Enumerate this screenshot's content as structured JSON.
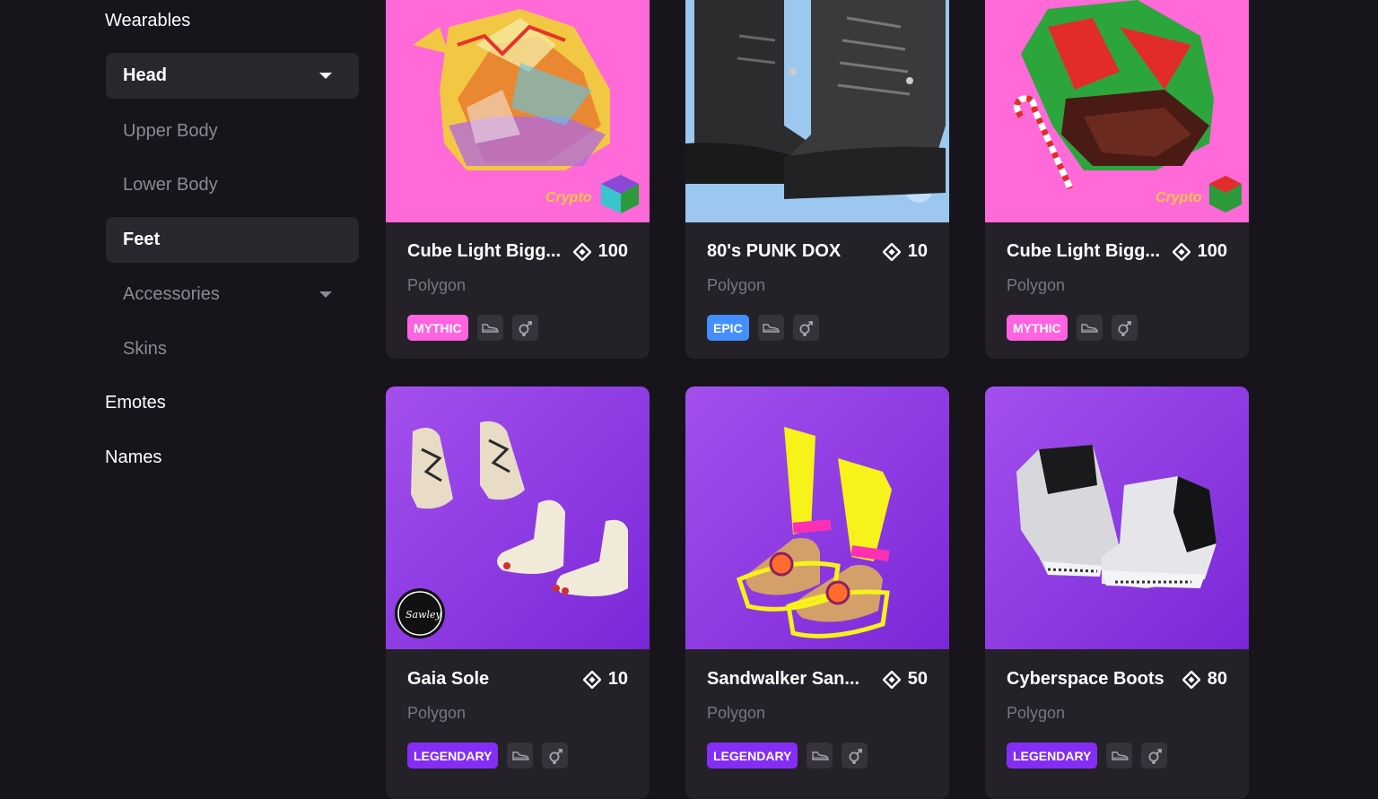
{
  "sidebar": {
    "wearables_title": "Wearables",
    "items": [
      {
        "label": "Head"
      },
      {
        "label": "Upper Body"
      },
      {
        "label": "Lower Body"
      },
      {
        "label": "Feet"
      },
      {
        "label": "Accessories"
      },
      {
        "label": "Skins"
      }
    ],
    "emotes_title": "Emotes",
    "names_title": "Names"
  },
  "cards": [
    {
      "name": "Cube Light Bigg...",
      "price": "100",
      "network": "Polygon",
      "rarity": "MYTHIC",
      "rarity_color": "#ff63e1"
    },
    {
      "name": "80's PUNK DOX",
      "price": "10",
      "network": "Polygon",
      "rarity": "EPIC",
      "rarity_color": "#438fff"
    },
    {
      "name": "Cube Light Bigg...",
      "price": "100",
      "network": "Polygon",
      "rarity": "MYTHIC",
      "rarity_color": "#ff63e1"
    },
    {
      "name": "Gaia Sole",
      "price": "10",
      "network": "Polygon",
      "rarity": "LEGENDARY",
      "rarity_color": "#842df4"
    },
    {
      "name": "Sandwalker San...",
      "price": "50",
      "network": "Polygon",
      "rarity": "LEGENDARY",
      "rarity_color": "#842df4"
    },
    {
      "name": "Cyberspace Boots",
      "price": "80",
      "network": "Polygon",
      "rarity": "LEGENDARY",
      "rarity_color": "#842df4"
    }
  ],
  "icons": {
    "price": "mana-diamond-icon",
    "category": "shoe-icon",
    "gender": "unisex-gender-icon"
  },
  "image_text": {
    "card1_logo": "Crypto",
    "card3_logo": "Crypto",
    "card4_logo": "Sawley"
  }
}
